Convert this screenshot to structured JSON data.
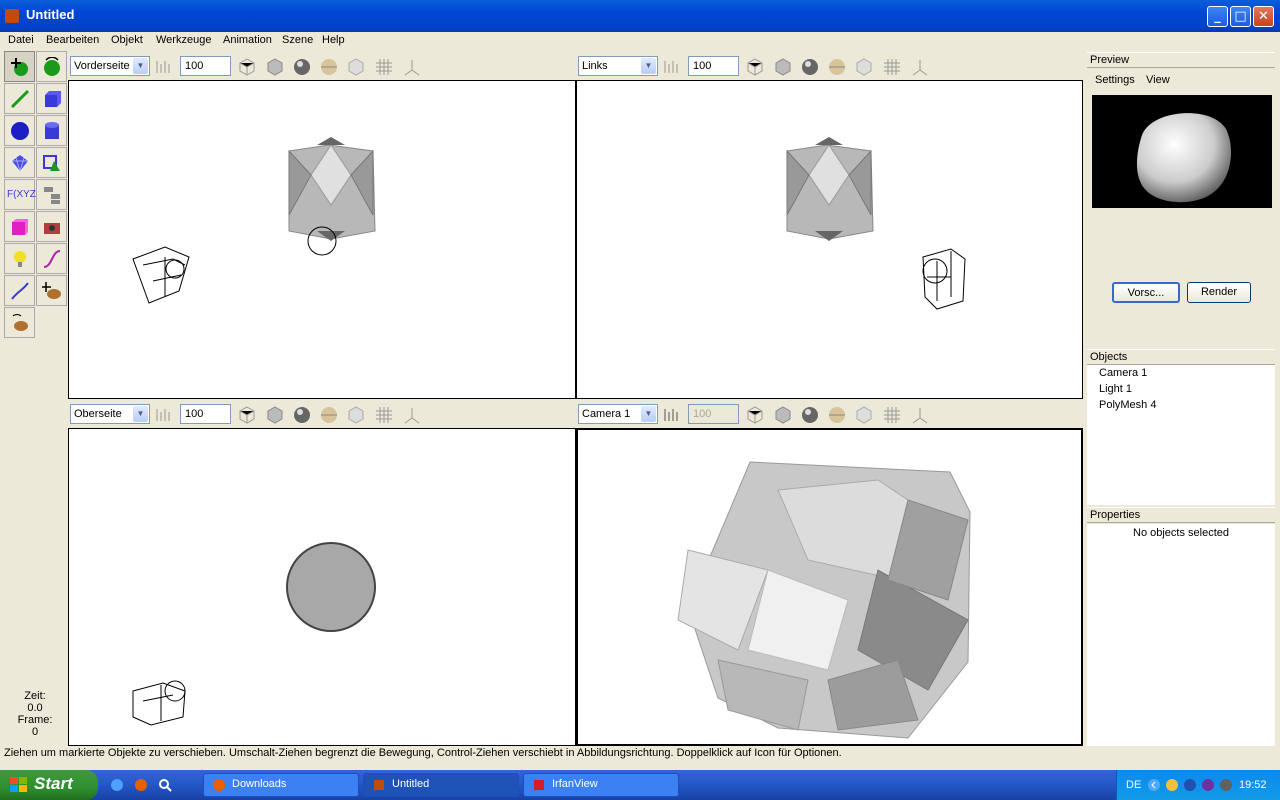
{
  "window": {
    "title": "Untitled"
  },
  "menu": [
    "Datei",
    "Bearbeiten",
    "Objekt",
    "Werkzeuge",
    "Animation",
    "Szene",
    "Help"
  ],
  "viewports": [
    {
      "view": "Vorderseite",
      "zoom": "100"
    },
    {
      "view": "Links",
      "zoom": "100"
    },
    {
      "view": "Oberseite",
      "zoom": "100"
    },
    {
      "view": "Camera 1",
      "zoom": "100",
      "zoom_disabled": true
    }
  ],
  "time_panel": {
    "zeit_label": "Zeit:",
    "zeit_value": "0.0",
    "frame_label": "Frame:",
    "frame_value": "0"
  },
  "tools": {
    "fxyz_label": "F(XYZ)"
  },
  "sidebar": {
    "preview_title": "Preview",
    "preview_tabs": [
      "Settings",
      "View"
    ],
    "preview_button": "Vorsc...",
    "render_button": "Render",
    "objects_title": "Objects",
    "objects": [
      "Camera 1",
      "Light 1",
      "PolyMesh 4"
    ],
    "properties_title": "Properties",
    "properties_empty": "No objects selected"
  },
  "statusbar": "Ziehen um markierte Objekte zu verschieben. Umschalt-Ziehen begrenzt die Bewegung, Control-Ziehen verschiebt in Abbildungsrichtung. Doppelklick auf Icon für Optionen.",
  "taskbar": {
    "start": "Start",
    "tasks": [
      "Downloads",
      "Untitled",
      "IrfanView"
    ],
    "language": "DE",
    "clock": "19:52"
  }
}
